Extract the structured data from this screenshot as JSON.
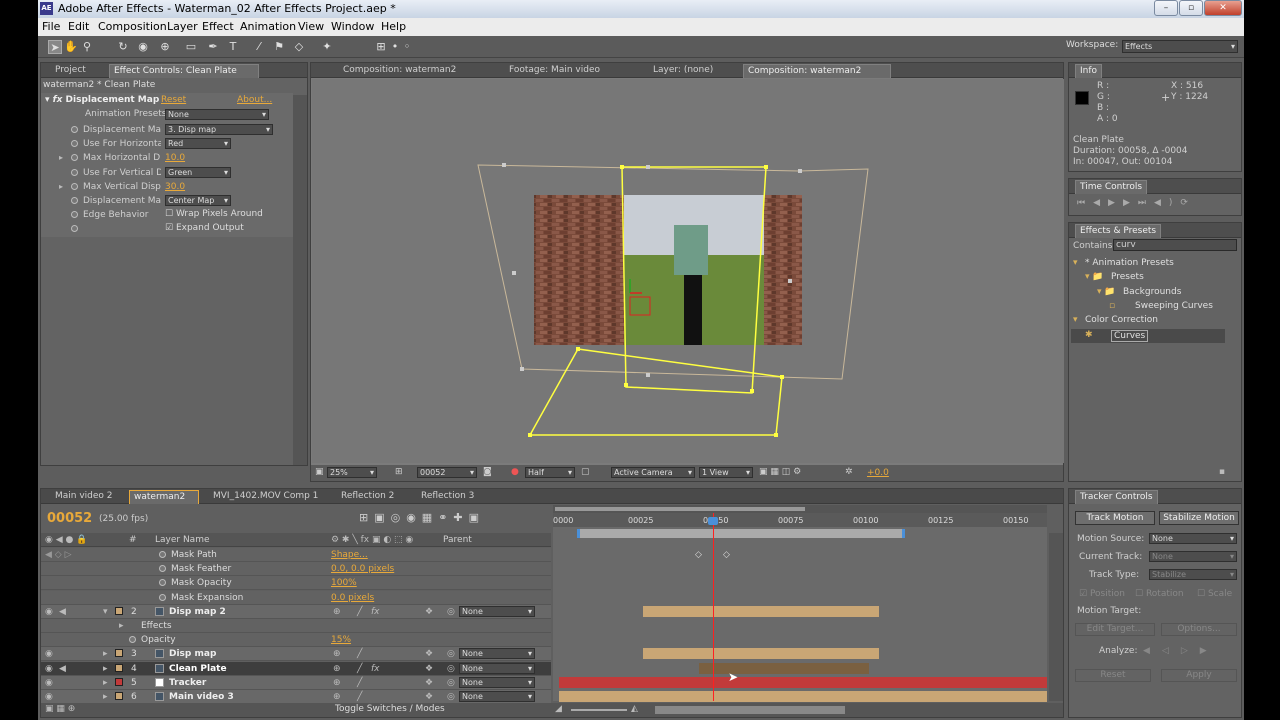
{
  "app": {
    "title": "Adobe After Effects - Waterman_02 After Effects Project.aep *",
    "logo": "AE"
  },
  "menu": [
    "File",
    "Edit",
    "Composition",
    "Layer",
    "Effect",
    "Animation",
    "View",
    "Window",
    "Help"
  ],
  "workspace": {
    "label": "Workspace:",
    "value": "Effects"
  },
  "effect_panel": {
    "tabs": [
      "Project",
      "Effect Controls: Clean Plate"
    ],
    "header": "waterman2 * Clean Plate",
    "effect_name": "Displacement Map",
    "reset": "Reset",
    "about": "About...",
    "presets_label": "Animation Presets:",
    "presets_value": "None",
    "rows": [
      {
        "label": "Displacement Map Lay",
        "value": "3. Disp map",
        "type": "dd"
      },
      {
        "label": "Use For Horizontal",
        "value": "Red",
        "type": "dd"
      },
      {
        "label": "Max Horizontal Dis",
        "value": "10.0",
        "type": "num"
      },
      {
        "label": "Use For Vertical Di",
        "value": "Green",
        "type": "dd"
      },
      {
        "label": "Max Vertical Displa",
        "value": "30.0",
        "type": "num"
      },
      {
        "label": "Displacement Map",
        "value": "Center Map",
        "type": "dd"
      },
      {
        "label": "Edge Behavior",
        "value": "Wrap Pixels Around",
        "type": "check"
      },
      {
        "label": "",
        "value": "Expand Output",
        "type": "checked"
      }
    ]
  },
  "comp_panel": {
    "tabs": [
      "Composition: waterman2",
      "Footage: Main video",
      "Layer: (none)",
      "Composition: waterman2"
    ],
    "zoom": "25%",
    "timecode": "00052",
    "resolution": "Half",
    "camera": "Active Camera",
    "views": "1 View",
    "exposure": "+0.0"
  },
  "info": {
    "tab": "Info",
    "r": "R :",
    "g": "G :",
    "b": "B :",
    "a": "A : 0",
    "x": "X : 516",
    "y": "Y : 1224",
    "name": "Clean Plate",
    "duration": "Duration: 00058, Δ -0004",
    "inout": "In: 00047, Out: 00104"
  },
  "time_controls": {
    "tab": "Time Controls"
  },
  "effects_presets": {
    "tab": "Effects & Presets",
    "contains_label": "Contains:",
    "contains_value": "curv",
    "tree": [
      {
        "label": "* Animation Presets",
        "level": 0,
        "kind": "root"
      },
      {
        "label": "Presets",
        "level": 1,
        "kind": "folder"
      },
      {
        "label": "Backgrounds",
        "level": 2,
        "kind": "folder"
      },
      {
        "label": "Sweeping Curves",
        "level": 3,
        "kind": "file"
      },
      {
        "label": "Color Correction",
        "level": 0,
        "kind": "root"
      },
      {
        "label": "Curves",
        "level": 1,
        "kind": "fx",
        "selected": true
      }
    ]
  },
  "timeline": {
    "tabs": [
      "Main video 2",
      "waterman2",
      "MVI_1402.MOV Comp 1",
      "Reflection 2",
      "Reflection 3"
    ],
    "timecode": "00052",
    "fps": "(25.00 fps)",
    "col_layer": "Layer Name",
    "col_parent": "Parent",
    "col_num": "#",
    "ruler": [
      "0000",
      "00025",
      "00050",
      "00075",
      "00100",
      "00125",
      "00150"
    ],
    "toggle": "Toggle Switches / Modes",
    "rows": [
      {
        "kind": "prop",
        "indent": 2,
        "name": "Mask Path",
        "value": "Shape..."
      },
      {
        "kind": "prop",
        "indent": 2,
        "name": "Mask Feather",
        "value": "0.0, 0.0 pixels"
      },
      {
        "kind": "prop",
        "indent": 2,
        "name": "Mask Opacity",
        "value": "100%"
      },
      {
        "kind": "prop",
        "indent": 2,
        "name": "Mask Expansion",
        "value": "0.0 pixels"
      },
      {
        "kind": "layer",
        "num": "2",
        "name": "Disp map 2",
        "label": "#c9a675",
        "parent": "None",
        "fx": true,
        "open": true
      },
      {
        "kind": "group",
        "indent": 1,
        "name": "Effects"
      },
      {
        "kind": "prop",
        "indent": 1,
        "name": "Opacity",
        "value": "15%"
      },
      {
        "kind": "layer",
        "num": "3",
        "name": "Disp map",
        "label": "#c9a675",
        "parent": "None"
      },
      {
        "kind": "layer",
        "num": "4",
        "name": "Clean Plate",
        "label": "#c9a675",
        "parent": "None",
        "fx": true,
        "selected": true
      },
      {
        "kind": "layer",
        "num": "5",
        "name": "Tracker",
        "label": "#c23a3a",
        "parent": "None",
        "solid": true
      },
      {
        "kind": "layer",
        "num": "6",
        "name": "Main video 3",
        "label": "#c9a675",
        "parent": "None"
      }
    ]
  },
  "tracker": {
    "tab": "Tracker Controls",
    "track_motion": "Track Motion",
    "stabilize_motion": "Stabilize Motion",
    "motion_source_label": "Motion Source:",
    "motion_source": "None",
    "current_track_label": "Current Track:",
    "current_track": "None",
    "track_type_label": "Track Type:",
    "track_type": "Stabilize",
    "position": "Position",
    "rotation": "Rotation",
    "scale": "Scale",
    "motion_target": "Motion Target:",
    "edit_target": "Edit Target...",
    "options": "Options...",
    "analyze": "Analyze:",
    "reset": "Reset",
    "apply": "Apply"
  },
  "colors": {
    "accent": "#e8a93a",
    "playhead": "#ff2020",
    "work_bar": "#c9a675",
    "tracker_bar": "#c23a3a",
    "yellow": "#ffff40"
  }
}
